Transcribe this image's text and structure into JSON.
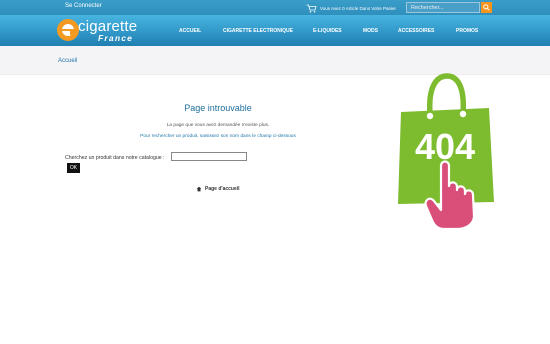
{
  "topbar": {
    "login": "Se Connecter",
    "cart_text": "Vous Avez 0 Article Dans Votre Panier",
    "search_placeholder": "Rechercher...",
    "icons": {
      "cart": "cart-icon",
      "search": "search-icon"
    },
    "search_button_color": "#f7941d"
  },
  "logo": {
    "word": "cigarette",
    "sub": "France",
    "accent": "#f49a20"
  },
  "nav": {
    "items": [
      "ACCUEIL",
      "CIGARETTE ELECTRONIQUE",
      "E-LIQUIDES",
      "MODS",
      "ACCESSOIRES",
      "PROMOS"
    ],
    "color": "#2f95c6"
  },
  "breadcrumb": {
    "home": "Accueil"
  },
  "main": {
    "title": "Page introuvable",
    "message": "La page que vous avez demandée n'existe plus.",
    "hint": "Pour rechercher un produit, saisissez son nom dans le champ ci-dessous",
    "search_label": "Cherchez un produit dans notre catalogue :",
    "search_value": "",
    "ok_label": "OK",
    "home_link": "Page d'accueil",
    "home_icon": "home-icon"
  },
  "illustration": {
    "code": "404",
    "bag_color": "#7dbb2f",
    "hand_color": "#d94f7a"
  }
}
